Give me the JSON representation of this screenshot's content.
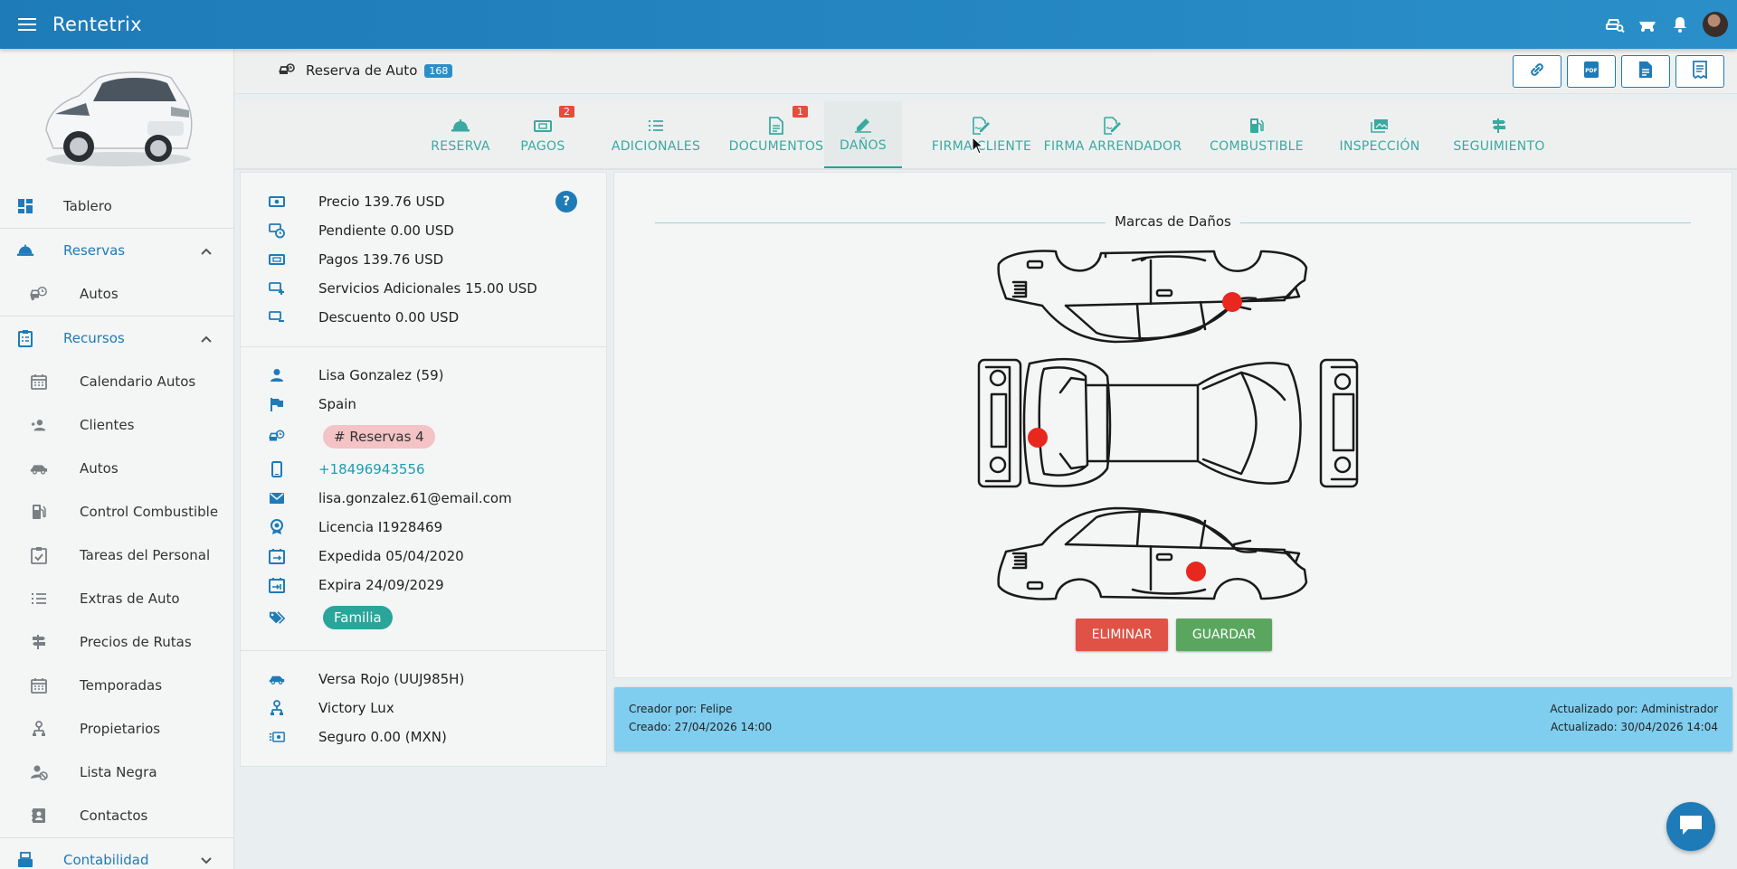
{
  "app": {
    "title": "Rentetrix"
  },
  "colors": {
    "primary": "#1e7bb8",
    "teal": "#1fa598",
    "danger": "#e05246",
    "success": "#5aa65f",
    "audit_bg": "#7fcdef"
  },
  "topbar": {
    "icons": [
      "car-search-icon",
      "car-wash-icon",
      "bell-icon",
      "user-avatar"
    ]
  },
  "sidebar": {
    "items": [
      {
        "label": "Tablero",
        "icon": "dashboard-icon"
      },
      {
        "label": "Reservas",
        "icon": "bell-service-icon",
        "section": true,
        "expanded": true
      },
      {
        "label": "Autos",
        "icon": "car-clock-icon"
      },
      {
        "label": "Recursos",
        "icon": "clipboard-icon",
        "section": true,
        "expanded": true
      },
      {
        "label": "Calendario Autos",
        "icon": "calendar-icon"
      },
      {
        "label": "Clientes",
        "icon": "users-icon"
      },
      {
        "label": "Autos",
        "icon": "car-icon"
      },
      {
        "label": "Control Combustible",
        "icon": "fuel-icon"
      },
      {
        "label": "Tareas del Personal",
        "icon": "task-icon"
      },
      {
        "label": "Extras de Auto",
        "icon": "list-icon"
      },
      {
        "label": "Precios de Rutas",
        "icon": "signpost-icon"
      },
      {
        "label": "Temporadas",
        "icon": "calendar-icon"
      },
      {
        "label": "Propietarios",
        "icon": "owner-icon"
      },
      {
        "label": "Lista Negra",
        "icon": "user-block-icon"
      },
      {
        "label": "Contactos",
        "icon": "contacts-icon"
      },
      {
        "label": "Contabilidad",
        "icon": "register-icon",
        "section": true,
        "expanded": false
      }
    ]
  },
  "header": {
    "title": "Reserva de Auto",
    "badge": "168",
    "actions": [
      "link-icon",
      "pdf-icon",
      "document-icon",
      "receipt-icon"
    ]
  },
  "tabs": [
    {
      "label": "RESERVA",
      "icon": "bell-service-icon"
    },
    {
      "label": "PAGOS",
      "icon": "money-icon",
      "badge": "2"
    },
    {
      "label": "ADICIONALES",
      "icon": "list-icon"
    },
    {
      "label": "DOCUMENTOS",
      "icon": "document-icon",
      "badge": "1"
    },
    {
      "label": "DAÑOS",
      "icon": "pencil-icon",
      "active": true
    },
    {
      "label": "FIRMA CLIENTE",
      "icon": "signature-icon"
    },
    {
      "label": "FIRMA ARRENDADOR",
      "icon": "signature-icon"
    },
    {
      "label": "COMBUSTIBLE",
      "icon": "fuel-icon"
    },
    {
      "label": "INSPECCIÓN",
      "icon": "gallery-icon"
    },
    {
      "label": "SEGUIMIENTO",
      "icon": "signpost-icon"
    }
  ],
  "info": {
    "help": "?",
    "finance": [
      {
        "text": "Precio 139.76 USD",
        "icon": "cash-icon"
      },
      {
        "text": "Pendiente 0.00 USD",
        "icon": "cash-clock-icon"
      },
      {
        "text": "Pagos 139.76 USD",
        "icon": "money-icon"
      },
      {
        "text": "Servicios Adicionales 15.00 USD",
        "icon": "cash-plus-icon"
      },
      {
        "text": "Descuento 0.00 USD",
        "icon": "cash-minus-icon"
      }
    ],
    "customer": {
      "name": "Lisa Gonzalez (59)",
      "country": "Spain",
      "reservations": "# Reservas 4",
      "phone": "+18496943556",
      "email": "lisa.gonzalez.61@email.com",
      "license": "Licencia I1928469",
      "issued": "Expedida 05/04/2020",
      "expires": "Expira 24/09/2029",
      "tag": "Familia"
    },
    "vehicle": {
      "car": "Versa Rojo (UUJ985H)",
      "owner": "Victory Lux",
      "insurance": "Seguro 0.00 (MXN)"
    }
  },
  "damage": {
    "title": "Marcas de Daños",
    "marks": [
      {
        "view": "top-side",
        "label": "rear-quarter"
      },
      {
        "view": "top-plan",
        "label": "front-left"
      },
      {
        "view": "bottom-side",
        "label": "rear-door"
      }
    ],
    "delete_label": "ELIMINAR",
    "save_label": "GUARDAR"
  },
  "audit": {
    "created_by": "Creador por: Felipe",
    "created": "Creado: 27/04/2026 14:00",
    "updated_by": "Actualizado por: Administrador",
    "updated": "Actualizado: 30/04/2026 14:04"
  }
}
